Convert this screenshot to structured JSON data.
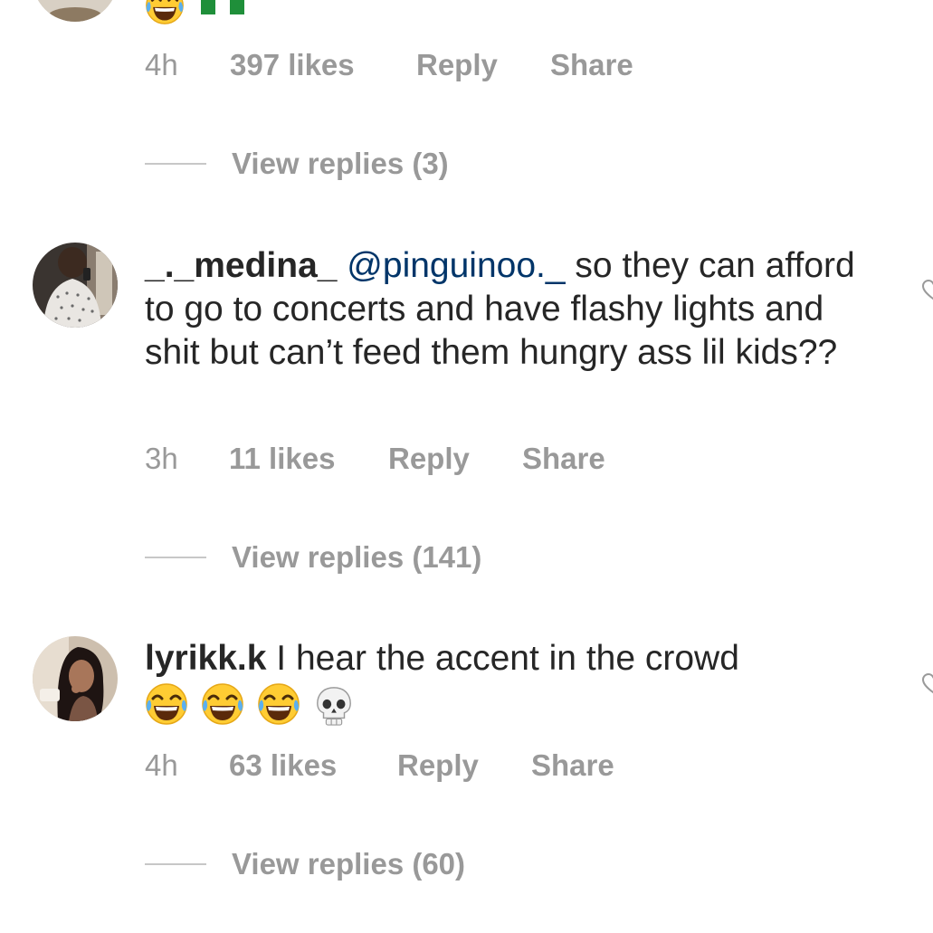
{
  "comments": [
    {
      "id": "top-partial",
      "emojis": [
        "face-with-tears-of-joy",
        "nigeria-flag"
      ],
      "time": "4h",
      "likes": "397 likes",
      "reply": "Reply",
      "share": "Share",
      "view_replies": "View replies (3)"
    },
    {
      "id": "medina",
      "username": "_._medina_",
      "mention": "@pinguinoo._",
      "text": " so they can afford to go to concerts and have flashy lights and shit but can’t feed them hungry ass lil kids??",
      "time": "3h",
      "likes": "11 likes",
      "reply": "Reply",
      "share": "Share",
      "view_replies": "View replies (141)"
    },
    {
      "id": "lyrikk",
      "username": "lyrikk.k",
      "text": " I hear the accent in the crowd",
      "emojis": [
        "face-with-tears-of-joy",
        "face-with-tears-of-joy",
        "face-with-tears-of-joy",
        "skull"
      ],
      "time": "4h",
      "likes": "63 likes",
      "reply": "Reply",
      "share": "Share",
      "view_replies": "View replies (60)"
    }
  ],
  "colors": {
    "text": "#262626",
    "mention": "#003569",
    "meta": "#999999",
    "divider": "#c7c7c7",
    "background": "#ffffff"
  }
}
